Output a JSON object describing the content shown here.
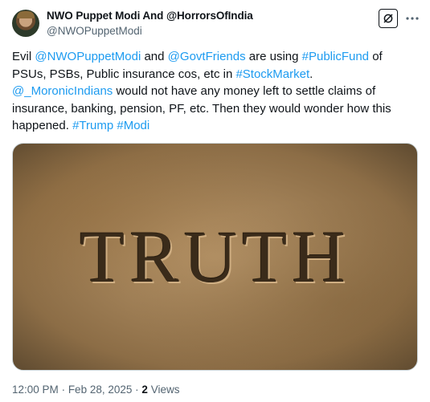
{
  "author": {
    "display_name": "NWO Puppet Modi And @HorrorsOfIndia",
    "handle": "@NWOPuppetModi"
  },
  "post": {
    "segments": [
      {
        "text": "Evil ",
        "link": false
      },
      {
        "text": "@NWOPuppetModi",
        "link": true
      },
      {
        "text": " and ",
        "link": false
      },
      {
        "text": "@GovtFriends",
        "link": true
      },
      {
        "text": " are using ",
        "link": false
      },
      {
        "text": "#PublicFund",
        "link": true
      },
      {
        "text": " of PSUs, PSBs, Public insurance cos, etc in ",
        "link": false
      },
      {
        "text": "#StockMarket",
        "link": true
      },
      {
        "text": ".",
        "link": false
      },
      {
        "text": "@_MoronicIndians",
        "link": true
      },
      {
        "text": " would not have any money left to settle claims of insurance, banking, pension, PF, etc. Then they would wonder how this happened. ",
        "link": false
      },
      {
        "text": "#Trump",
        "link": true
      },
      {
        "text": " ",
        "link": false
      },
      {
        "text": "#Modi",
        "link": true
      }
    ],
    "image_text": "TRUTH"
  },
  "meta": {
    "time": "12:00 PM",
    "date": "Feb 28, 2025",
    "views_count": "2",
    "views_label": "Views"
  },
  "icons": {
    "grok": "grok-icon",
    "more": "more-icon"
  },
  "colors": {
    "link": "#1d9bf0",
    "text": "#0f1419",
    "secondary": "#536471"
  }
}
